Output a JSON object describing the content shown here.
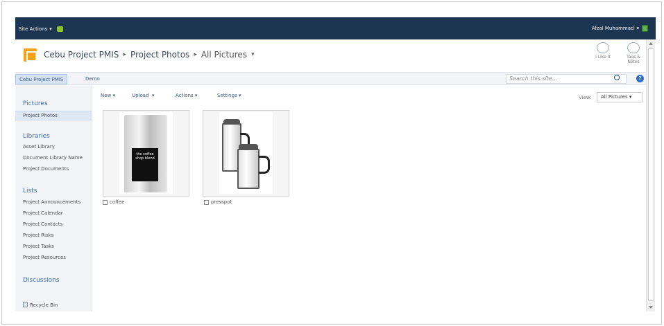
{
  "ribbon": {
    "site_actions_label": "Site Actions",
    "user_name": "Afzal Muhammad"
  },
  "breadcrumb": {
    "site": "Cebu Project PMIS",
    "list": "Project Photos",
    "view": "All Pictures"
  },
  "social": {
    "like": "I Like It",
    "tags_line1": "Tags &",
    "tags_line2": "Notes"
  },
  "topnav": {
    "items": [
      "Cebu Project PMIS",
      "Demo"
    ],
    "search_placeholder": "Search this site..."
  },
  "toolbar": {
    "new": "New",
    "upload": "Upload",
    "actions": "Actions",
    "settings": "Settings",
    "view_label": "View:",
    "view_value": "All Pictures"
  },
  "leftnav": {
    "pictures_heading": "Pictures",
    "pictures_items": [
      "Project Photos"
    ],
    "libraries_heading": "Libraries",
    "libraries_items": [
      "Asset Library",
      "Document Library Name",
      "Project Documents"
    ],
    "lists_heading": "Lists",
    "lists_items": [
      "Project Announcements",
      "Project Calendar",
      "Project Contacts",
      "Project Risks",
      "Project Tasks",
      "Project Resources"
    ],
    "discussions_heading": "Discussions",
    "recycle_bin": "Recycle Bin"
  },
  "pictures": [
    {
      "name": "coffee",
      "label_text": "the coffee shop blend"
    },
    {
      "name": "presspot"
    }
  ]
}
